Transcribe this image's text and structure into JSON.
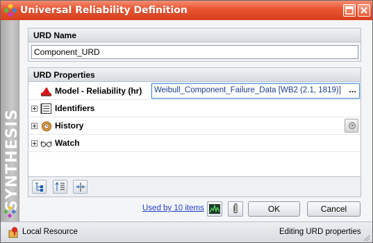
{
  "window": {
    "title": "Universal Reliability Definition",
    "accent_color": "#e8532f",
    "side_text": "SYNTHESIS"
  },
  "name_section": {
    "header": "URD Name",
    "value": "Component_URD"
  },
  "properties": {
    "header": "URD Properties",
    "rows": [
      {
        "label": "Model - Reliability (hr)",
        "value": "Weibull_Component_Failure_Data [WB2 (2.1, 1819)]",
        "ellipsis": "...",
        "icon": "reliability-curve-icon"
      },
      {
        "label": "Identifiers",
        "icon": "identifiers-list-icon"
      },
      {
        "label": "History",
        "icon": "history-icon"
      },
      {
        "label": "Watch",
        "icon": "watch-glasses-icon"
      }
    ]
  },
  "toolbar": {
    "icons": [
      "expand-all-icon",
      "collapse-all-icon",
      "columns-icon"
    ]
  },
  "actions": {
    "used_by": "Used by 10 items",
    "ok": "OK",
    "cancel": "Cancel"
  },
  "status": {
    "left": "Local Resource",
    "right": "Editing URD properties"
  }
}
